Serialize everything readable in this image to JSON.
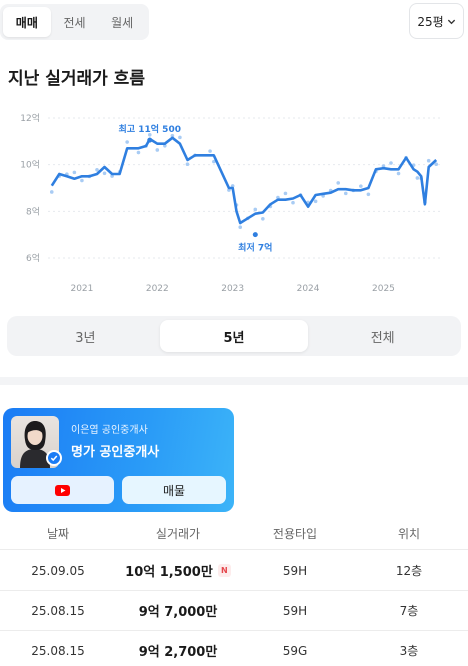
{
  "deal_tabs": [
    {
      "label": "매매",
      "active": true
    },
    {
      "label": "전세",
      "active": false
    },
    {
      "label": "월세",
      "active": false
    }
  ],
  "size_select": {
    "value": "25평",
    "icon": "chevron-down-icon"
  },
  "section_title": "지난 실거래가 흐름",
  "chart_data": {
    "type": "line",
    "y_ticks": [
      "12억",
      "10억",
      "8억",
      "6억"
    ],
    "y_tick_values": [
      12,
      10,
      8,
      6
    ],
    "x_ticks": [
      "2021",
      "2022",
      "2023",
      "2024",
      "2025"
    ],
    "x_tick_values": [
      2021,
      2022,
      2023,
      2024,
      2025
    ],
    "ylim": [
      6,
      12
    ],
    "xlim": [
      2020.55,
      2025.75
    ],
    "grid": true,
    "series": [
      {
        "x": [
          2020.6,
          2020.7,
          2020.8,
          2020.9,
          2021.0,
          2021.1,
          2021.2,
          2021.3,
          2021.4,
          2021.5,
          2021.6,
          2021.75,
          2021.85,
          2021.9,
          2022.0,
          2022.1,
          2022.2,
          2022.3,
          2022.4,
          2022.5,
          2022.7,
          2022.75,
          2022.95,
          2023.0,
          2023.05,
          2023.1,
          2023.2,
          2023.3,
          2023.4,
          2023.5,
          2023.6,
          2023.7,
          2023.8,
          2023.9,
          2024.0,
          2024.1,
          2024.2,
          2024.3,
          2024.4,
          2024.5,
          2024.6,
          2024.7,
          2024.8,
          2024.9,
          2025.0,
          2025.1,
          2025.2,
          2025.3,
          2025.4,
          2025.45,
          2025.5,
          2025.55,
          2025.6,
          2025.7
        ],
        "y": [
          9.1,
          9.6,
          9.5,
          9.4,
          9.5,
          9.5,
          9.6,
          9.9,
          9.6,
          9.6,
          10.7,
          10.7,
          10.8,
          11.1,
          10.9,
          10.9,
          11.15,
          10.9,
          10.2,
          10.4,
          10.4,
          10.4,
          9.0,
          9.0,
          8.0,
          7.5,
          7.7,
          7.9,
          7.95,
          8.3,
          8.5,
          8.5,
          8.55,
          8.7,
          8.2,
          8.7,
          8.75,
          8.8,
          8.95,
          8.95,
          8.9,
          8.9,
          9.0,
          9.8,
          9.85,
          9.8,
          9.8,
          10.3,
          9.8,
          9.7,
          9.5,
          8.3,
          9.9,
          10.2
        ]
      }
    ],
    "annotations": [
      {
        "text": "최고 11억 500",
        "x": 2021.9,
        "y": 11.05
      },
      {
        "text": "최저 7억",
        "x": 2023.3,
        "y": 7.0
      }
    ],
    "colors": {
      "line": "#2f7fe0",
      "points": "#a9ccf4",
      "grid": "#e6e9ee"
    }
  },
  "period_tabs": [
    {
      "label": "3년",
      "active": false
    },
    {
      "label": "5년",
      "active": true
    },
    {
      "label": "전체",
      "active": false
    }
  ],
  "agent": {
    "subtitle": "이은엽 공인중개사",
    "name": "명가 공인중개사",
    "youtube_icon": "youtube-icon",
    "listing_label": "매물",
    "verified_icon": "check-badge-icon"
  },
  "table": {
    "headers": [
      "날짜",
      "실거래가",
      "전용타입",
      "위치"
    ],
    "rows": [
      {
        "date": "25.09.05",
        "price": "10억 1,500만",
        "badge": "N",
        "type": "59H",
        "floor": "12층"
      },
      {
        "date": "25.08.15",
        "price": "9억 7,000만",
        "badge": "",
        "type": "59H",
        "floor": "7층"
      },
      {
        "date": "25.08.15",
        "price": "9억 2,700만",
        "badge": "",
        "type": "59G",
        "floor": "3층"
      }
    ]
  }
}
